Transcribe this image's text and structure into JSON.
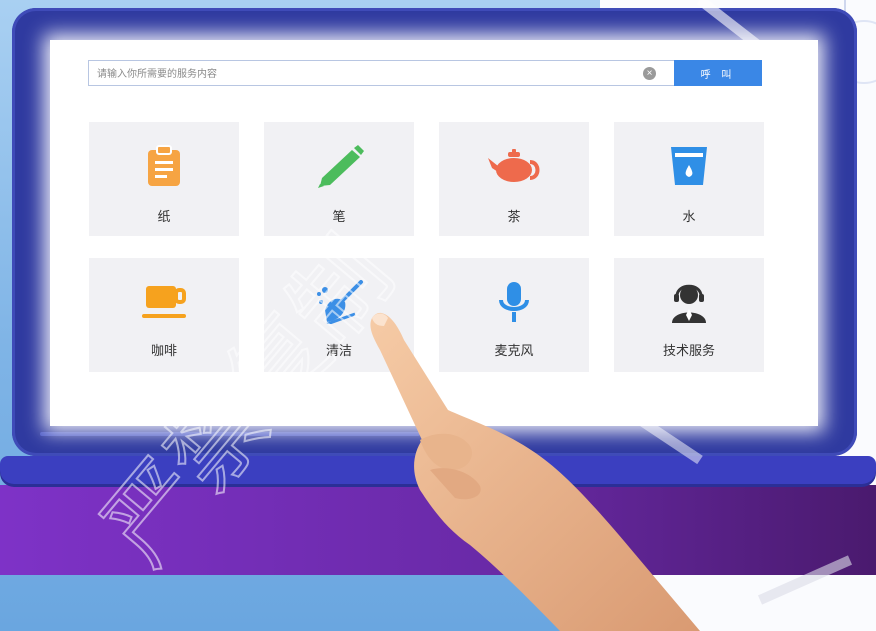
{
  "search": {
    "placeholder": "请输入你所需要的服务内容",
    "call_label": "呼 叫"
  },
  "services": [
    {
      "label": "纸",
      "icon": "clipboard-icon",
      "color": "#f6a443"
    },
    {
      "label": "笔",
      "icon": "pencil-icon",
      "color": "#4cbc5c"
    },
    {
      "label": "茶",
      "icon": "teapot-icon",
      "color": "#ee6a4c"
    },
    {
      "label": "水",
      "icon": "water-cup-icon",
      "color": "#2f8fe6"
    },
    {
      "label": "咖啡",
      "icon": "coffee-cup-icon",
      "color": "#f6a21e"
    },
    {
      "label": "清洁",
      "icon": "broom-icon",
      "color": "#3c8fe6"
    },
    {
      "label": "麦克风",
      "icon": "microphone-icon",
      "color": "#2f8fe6"
    },
    {
      "label": "技术服务",
      "icon": "headset-agent-icon",
      "color": "#333333"
    }
  ],
  "watermark": {
    "text": "严禁复制"
  }
}
